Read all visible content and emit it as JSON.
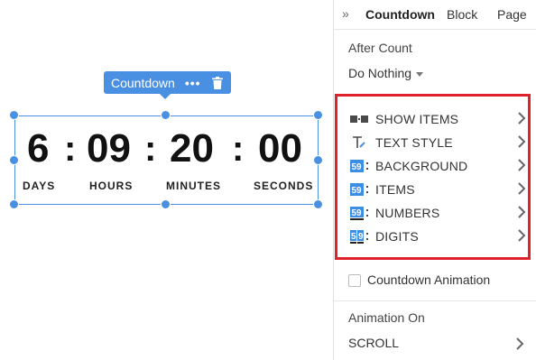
{
  "canvas": {
    "toolbar": {
      "title": "Countdown",
      "more_glyph": "•••",
      "trash_icon": "trash-icon"
    },
    "countdown": {
      "days": "6",
      "hours": "09",
      "minutes": "20",
      "seconds": "00",
      "separator": ":",
      "labels": {
        "days": "DAYS",
        "hours": "HOURS",
        "minutes": "MINUTES",
        "seconds": "SECONDS"
      }
    }
  },
  "panel": {
    "collapse_glyph": "»",
    "tabs": [
      {
        "label": "Countdown",
        "active": true
      },
      {
        "label": "Block",
        "active": false
      },
      {
        "label": "Page",
        "active": false
      }
    ],
    "after_count": {
      "label": "After Count",
      "value": "Do Nothing"
    },
    "highlight_color": "#e0202b",
    "items": [
      {
        "label": "SHOW ITEMS",
        "icon": "show-items-icon"
      },
      {
        "label": "TEXT STYLE",
        "icon": "text-style-icon"
      },
      {
        "label": "BACKGROUND",
        "icon": "background-icon"
      },
      {
        "label": "ITEMS",
        "icon": "items-icon"
      },
      {
        "label": "NUMBERS",
        "icon": "numbers-icon"
      },
      {
        "label": "DIGITS",
        "icon": "digits-icon"
      }
    ],
    "countdown_animation": {
      "label": "Countdown Animation",
      "checked": false
    },
    "animation_on": {
      "label": "Animation On",
      "value": "SCROLL"
    }
  }
}
